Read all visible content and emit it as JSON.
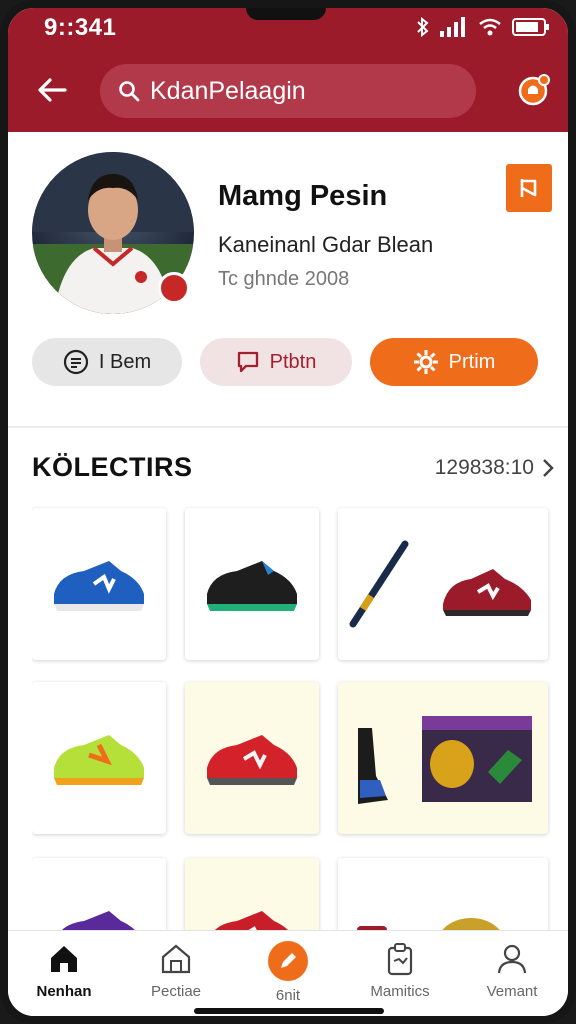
{
  "status_bar": {
    "time": "9::341"
  },
  "header": {
    "search_text": "KdanPelaagin"
  },
  "profile": {
    "name": "Mamg Pesin",
    "subtitle": "Kaneinanl Gdar Blean",
    "since": "Tc ghnde 2008"
  },
  "actions": [
    {
      "label": "I Bem",
      "icon": "chat-icon"
    },
    {
      "label": "Ptbtn",
      "icon": "message-icon"
    },
    {
      "label": "Prtim",
      "icon": "gear-icon"
    }
  ],
  "collection": {
    "title": "KÖLECTIRS",
    "count": "129838:10"
  },
  "items": [
    {
      "name": "blue-sneaker"
    },
    {
      "name": "black-green-sneaker"
    },
    {
      "name": "pen-and-red-sneaker"
    },
    {
      "name": "yellow-green-sneaker"
    },
    {
      "name": "red-sneaker"
    },
    {
      "name": "black-boot-and-boxset"
    },
    {
      "name": "purple-sneaker"
    },
    {
      "name": "red-white-sneaker"
    },
    {
      "name": "mug-and-trophy"
    }
  ],
  "nav": [
    {
      "label": "Nenhan",
      "icon": "home-icon",
      "active": true
    },
    {
      "label": "Pectiae",
      "icon": "store-icon"
    },
    {
      "label": "6nit",
      "icon": "edit-icon"
    },
    {
      "label": "Mamitics",
      "icon": "clipboard-icon"
    },
    {
      "label": "Vemant",
      "icon": "user-icon"
    }
  ],
  "colors": {
    "brand": "#9b1b2b",
    "accent": "#ef6c1a"
  }
}
